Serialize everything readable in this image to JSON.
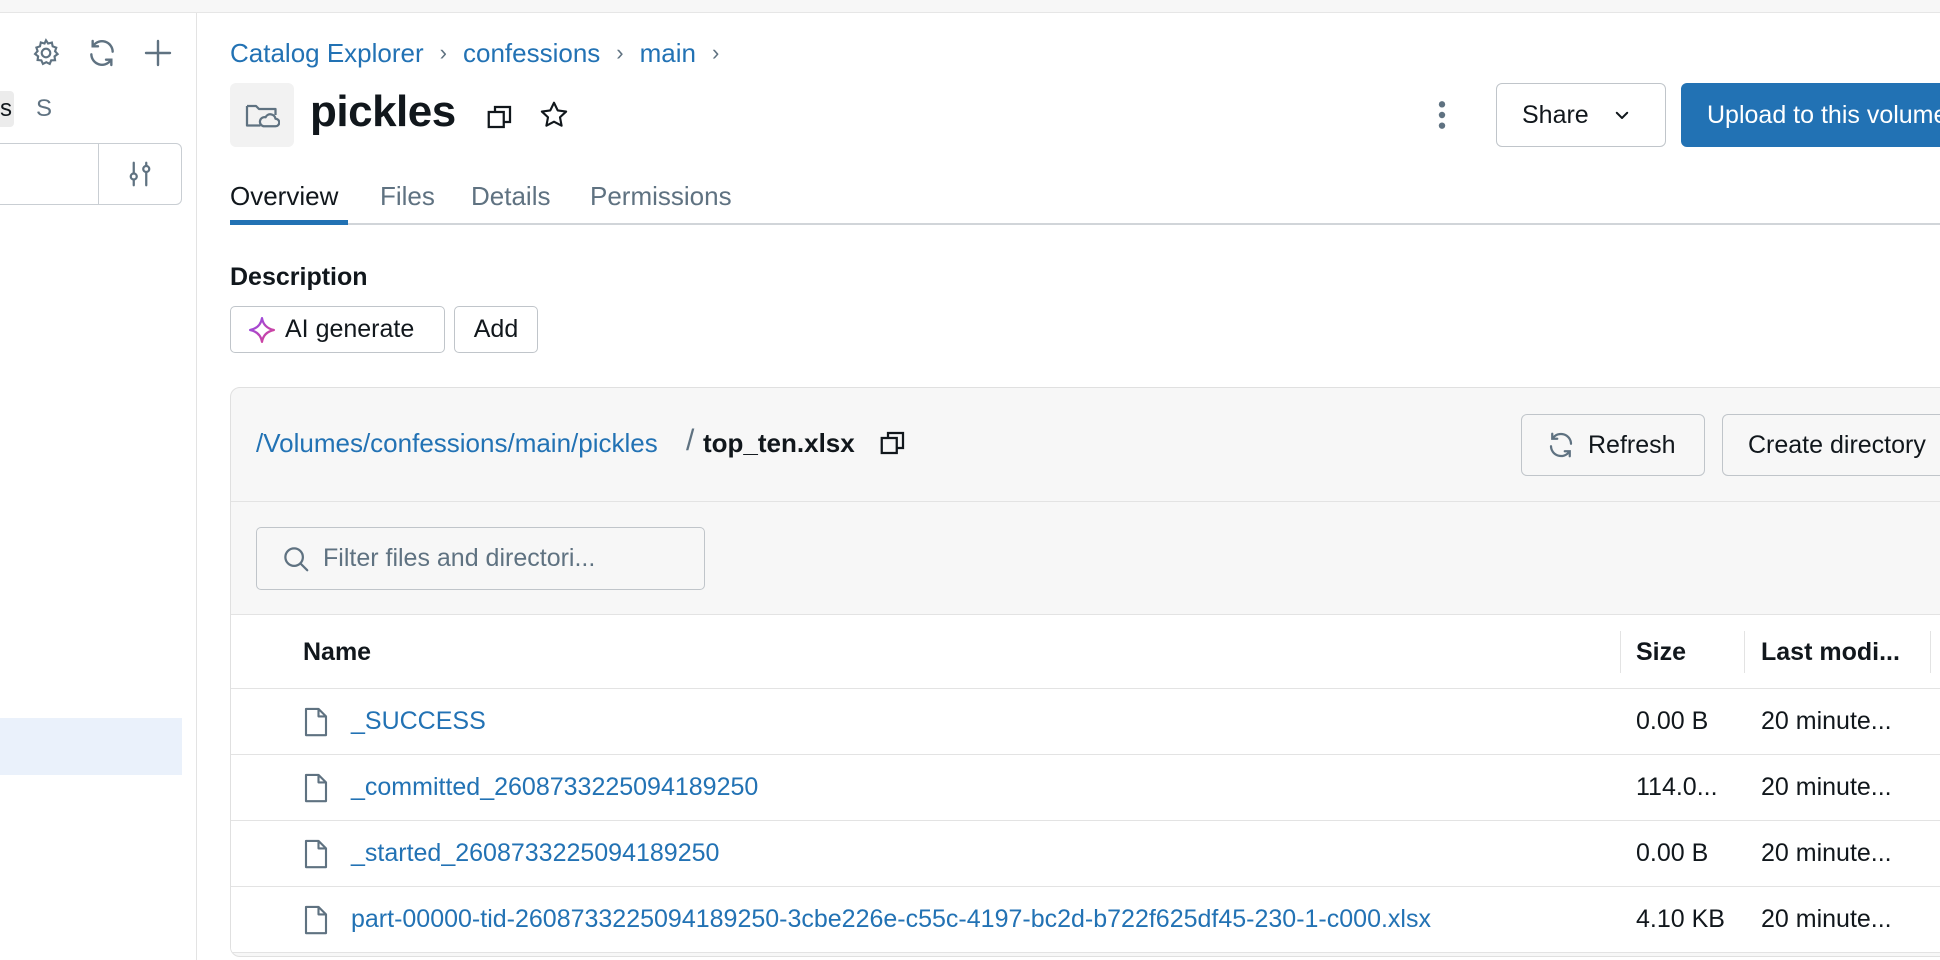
{
  "sidebar": {
    "tab_a_label": "s",
    "tab_b_label": "S",
    "icons": [
      "gear-icon",
      "refresh-icon",
      "plus-icon",
      "filter-sliders-icon"
    ]
  },
  "breadcrumb": {
    "items": [
      "Catalog Explorer",
      "confessions",
      "main"
    ],
    "separator": "›"
  },
  "header": {
    "title": "pickles",
    "share_label": "Share",
    "upload_label": "Upload to this volume"
  },
  "tabs": {
    "items": [
      "Overview",
      "Files",
      "Details",
      "Permissions"
    ],
    "active": "Overview"
  },
  "description": {
    "label": "Description",
    "ai_generate_label": "AI generate",
    "add_label": "Add"
  },
  "browser": {
    "path": "/Volumes/confessions/main/pickles",
    "path_separator": "/",
    "current_file": "top_ten.xlsx",
    "refresh_label": "Refresh",
    "create_directory_label": "Create directory",
    "filter_placeholder": "Filter files and directori..."
  },
  "table": {
    "columns": [
      "Name",
      "Size",
      "Last modi..."
    ],
    "rows": [
      {
        "name": "_SUCCESS",
        "size": "0.00 B",
        "modified": "20 minute..."
      },
      {
        "name": "_committed_2608733225094189250",
        "size": "114.0...",
        "modified": "20 minute..."
      },
      {
        "name": "_started_2608733225094189250",
        "size": "0.00 B",
        "modified": "20 minute..."
      },
      {
        "name": "part-00000-tid-2608733225094189250-3cbe226e-c55c-4197-bc2d-b722f625df45-230-1-c000.xlsx",
        "size": "4.10 KB",
        "modified": "20 minute..."
      }
    ]
  },
  "colors": {
    "accent": "#2272b4",
    "text": "#11171c",
    "muted": "#5f7281",
    "panel_bg": "#f7f7f7",
    "selected_bg": "#eaf1fb"
  }
}
